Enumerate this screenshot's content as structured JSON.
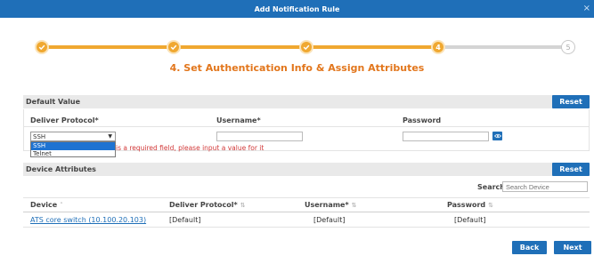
{
  "dialog": {
    "title": "Add Notification Rule",
    "close_glyph": "×"
  },
  "stepper": {
    "steps": [
      {
        "state": "done",
        "label": ""
      },
      {
        "state": "done",
        "label": ""
      },
      {
        "state": "done",
        "label": ""
      },
      {
        "state": "current",
        "label": "4"
      },
      {
        "state": "todo",
        "label": "5"
      }
    ],
    "title": "4. Set Authentication Info & Assign Attributes"
  },
  "default_value": {
    "header": "Default Value",
    "reset_label": "Reset",
    "columns": {
      "protocol": "Deliver Protocol*",
      "username": "Username*",
      "password": "Password"
    },
    "protocol_value": "SSH",
    "protocol_options": [
      "SSH",
      "Telnet"
    ],
    "username_value": "",
    "password_value": "",
    "error_text": "is a required field, please input a value for it"
  },
  "device_attributes": {
    "header": "Device Attributes",
    "reset_label": "Reset",
    "search_label": "Search:",
    "search_placeholder": "Search Device",
    "columns": [
      "Device",
      "Deliver Protocol*",
      "Username*",
      "Password"
    ],
    "sort_glyphs": [
      "˄",
      "⇅",
      "⇅",
      "⇅"
    ],
    "rows": [
      {
        "device": "ATS core switch (10.100.20.103)",
        "protocol": "[Default]",
        "username": "[Default]",
        "password": "[Default]"
      }
    ]
  },
  "footer": {
    "back_label": "Back",
    "next_label": "Next"
  },
  "colors": {
    "accent": "#1f6fb8",
    "step": "#f0a830",
    "title": "#e2761c",
    "error": "#d23a3a"
  }
}
